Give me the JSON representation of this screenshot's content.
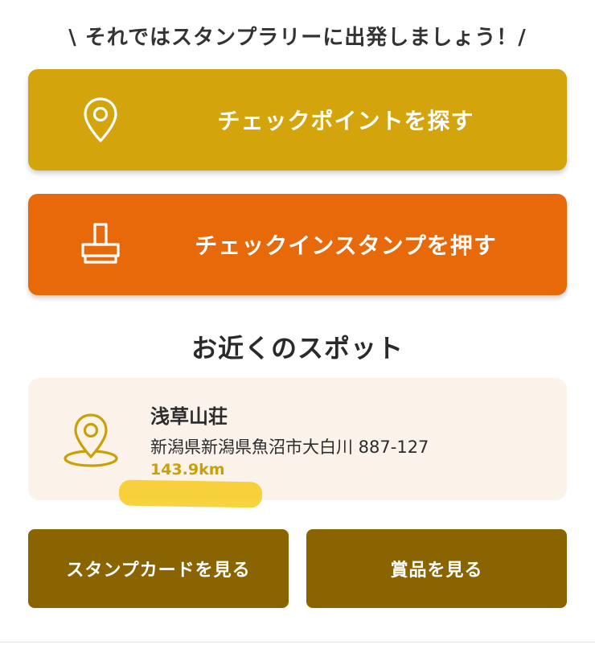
{
  "headline": "\\ それではスタンプラリーに出発しましょう！/",
  "actions": {
    "find_checkpoint": {
      "label": "チェックポイントを探す",
      "icon": "map-pin-icon",
      "color": "#D4A40D"
    },
    "checkin_stamp": {
      "label": "チェックインスタンプを押す",
      "icon": "stamp-icon",
      "color": "#E8690A"
    }
  },
  "nearby": {
    "title": "お近くのスポット",
    "spot": {
      "name": "浅草山荘",
      "address": "新潟県新潟県魚沼市大白川 887-127",
      "distance": "143.9km",
      "icon": "location-pin-icon",
      "card_color": "#FBF3EA",
      "accent_color": "#C9A005"
    },
    "highlight_color": "#F5C400"
  },
  "bottom_buttons": {
    "stamp_card": {
      "label": "スタンプカードを見る"
    },
    "prizes": {
      "label": "賞品を見る"
    },
    "color": "#8A6400"
  }
}
